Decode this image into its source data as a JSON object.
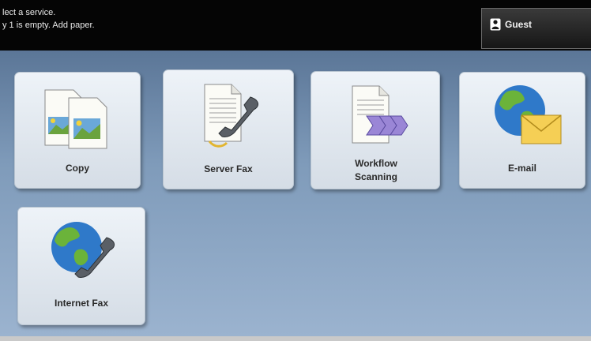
{
  "status": {
    "line1": "lect a service.",
    "line2": "y 1 is empty.  Add paper."
  },
  "user": {
    "label": "Guest",
    "icon": "user-lock-icon"
  },
  "services": [
    {
      "label": "Copy",
      "icon": "copy-icon"
    },
    {
      "label": "Server Fax",
      "icon": "server-fax-icon"
    },
    {
      "label": "Workflow Scanning",
      "icon": "workflow-scanning-icon"
    },
    {
      "label": "E-mail",
      "icon": "email-icon"
    },
    {
      "label": "Internet Fax",
      "icon": "internet-fax-icon"
    }
  ]
}
